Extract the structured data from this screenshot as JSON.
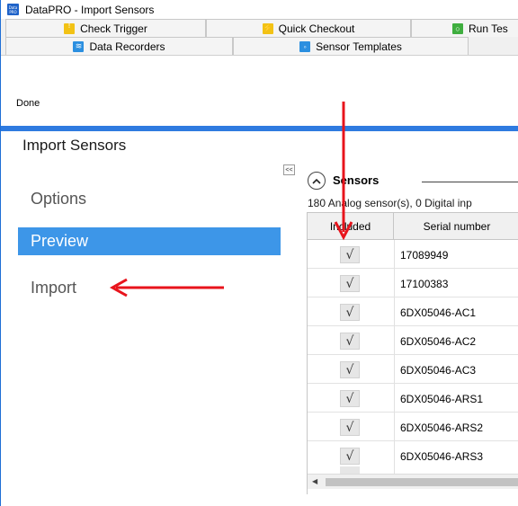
{
  "window": {
    "title": "DataPRO - Import Sensors",
    "app_icon_text": "Data PRO"
  },
  "tabs": {
    "row1": [
      {
        "label": "Check Trigger",
        "icon": "trigger-icon",
        "color": "#f2c215"
      },
      {
        "label": "Quick Checkout",
        "icon": "checkout-icon",
        "color": "#f2c215"
      },
      {
        "label": "Run Tes",
        "icon": "run-test-icon",
        "color": "#3fae3f"
      }
    ],
    "row2": [
      {
        "label": "Data Recorders",
        "icon": "data-recorders-icon",
        "color": "#2b8fe0"
      },
      {
        "label": "Sensor Templates",
        "icon": "sensor-templates-icon",
        "color": "#2b8fe0"
      }
    ]
  },
  "status": {
    "text": "Done"
  },
  "sidebar": {
    "title": "Import Sensors",
    "items": [
      {
        "label": "Options",
        "selected": false
      },
      {
        "label": "Preview",
        "selected": true
      },
      {
        "label": "Import",
        "selected": false
      }
    ]
  },
  "sensors": {
    "collapse_label": "<<",
    "expand_glyph": "^",
    "title": "Sensors",
    "summary": "180 Analog sensor(s), 0 Digital inp",
    "columns": [
      "Included",
      "Serial number"
    ],
    "rows": [
      {
        "included": true,
        "serial": "17089949"
      },
      {
        "included": true,
        "serial": "17100383"
      },
      {
        "included": true,
        "serial": "6DX05046-AC1"
      },
      {
        "included": true,
        "serial": "6DX05046-AC2"
      },
      {
        "included": true,
        "serial": "6DX05046-AC3"
      },
      {
        "included": true,
        "serial": "6DX05046-ARS1"
      },
      {
        "included": true,
        "serial": "6DX05046-ARS2"
      },
      {
        "included": true,
        "serial": "6DX05046-ARS3"
      }
    ],
    "check_glyph": "√"
  },
  "colors": {
    "accent": "#2f7be0",
    "selected_nav": "#3d96e8",
    "annotation_arrow": "#e8141c"
  }
}
